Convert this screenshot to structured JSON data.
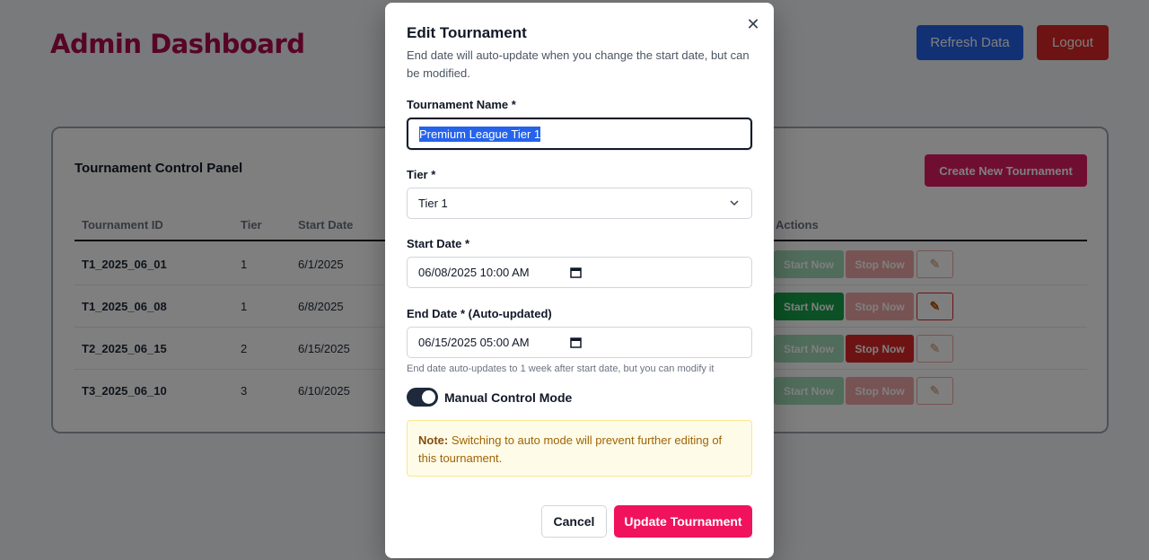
{
  "header": {
    "title": "Admin Dashboard",
    "refresh_label": "Refresh Data",
    "logout_label": "Logout"
  },
  "panel": {
    "title": "Tournament Control Panel",
    "create_label": "Create New Tournament",
    "columns": [
      "Tournament ID",
      "Tier",
      "Start Date",
      "Actions"
    ],
    "rows": [
      {
        "id": "T1_2025_06_01",
        "tier": "1",
        "start": "6/1/2025",
        "start_enabled": false,
        "stop_enabled": false
      },
      {
        "id": "T1_2025_06_08",
        "tier": "1",
        "start": "6/8/2025",
        "start_enabled": true,
        "stop_enabled": false
      },
      {
        "id": "T2_2025_06_15",
        "tier": "2",
        "start": "6/15/2025",
        "start_enabled": false,
        "stop_enabled": true
      },
      {
        "id": "T3_2025_06_10",
        "tier": "3",
        "start": "6/10/2025",
        "start_enabled": false,
        "stop_enabled": false
      }
    ],
    "start_label": "Start Now",
    "stop_label": "Stop Now"
  },
  "modal": {
    "title": "Edit Tournament",
    "description": "End date will auto-update when you change the start date, but can be modified.",
    "name_label": "Tournament Name *",
    "name_value": "Premium League Tier 1",
    "tier_label": "Tier *",
    "tier_value": "Tier 1",
    "start_label": "Start Date *",
    "start_value": "06/08/2025 10:00 AM",
    "end_label": "End Date * (Auto-updated)",
    "end_value": "06/15/2025 05:00 AM",
    "end_hint": "End date auto-updates to 1 week after start date, but you can modify it",
    "manual_label": "Manual Control Mode",
    "manual_on": true,
    "note_bold": "Note:",
    "note_text": "Switching to auto mode will prevent further editing of this tournament.",
    "cancel_label": "Cancel",
    "update_label": "Update Tournament"
  },
  "colors": {
    "brand": "#e11d65",
    "title": "#ad0a4b",
    "refresh": "#2563eb",
    "logout": "#dc2626"
  }
}
